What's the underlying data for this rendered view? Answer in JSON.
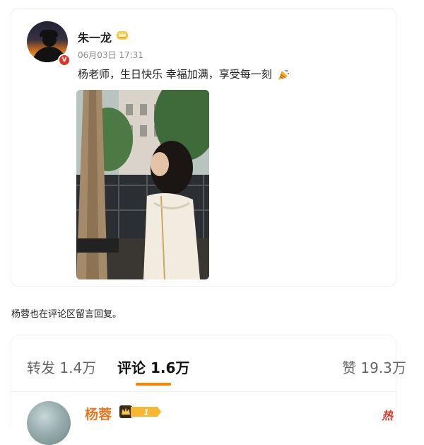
{
  "post": {
    "author": "朱一龙",
    "timestamp": "06月03日 17:31",
    "text": "杨老师，生日快乐 幸福加满，享受每一刻"
  },
  "caption": "杨蓉也在评论区留言回复。",
  "stats": {
    "repost": "转发 1.4万",
    "comment": "评论 1.6万",
    "like": "赞 19.3万"
  },
  "comment": {
    "name": "杨蓉",
    "vip_level": "1",
    "hot": "热"
  },
  "colors": {
    "accent": "#ff8200",
    "comment_name": "#e6761f",
    "hot": "#e0352b"
  },
  "icons": [
    "verified-icon",
    "crown-badge-icon",
    "party-popper-icon",
    "vip-badge-icon"
  ]
}
